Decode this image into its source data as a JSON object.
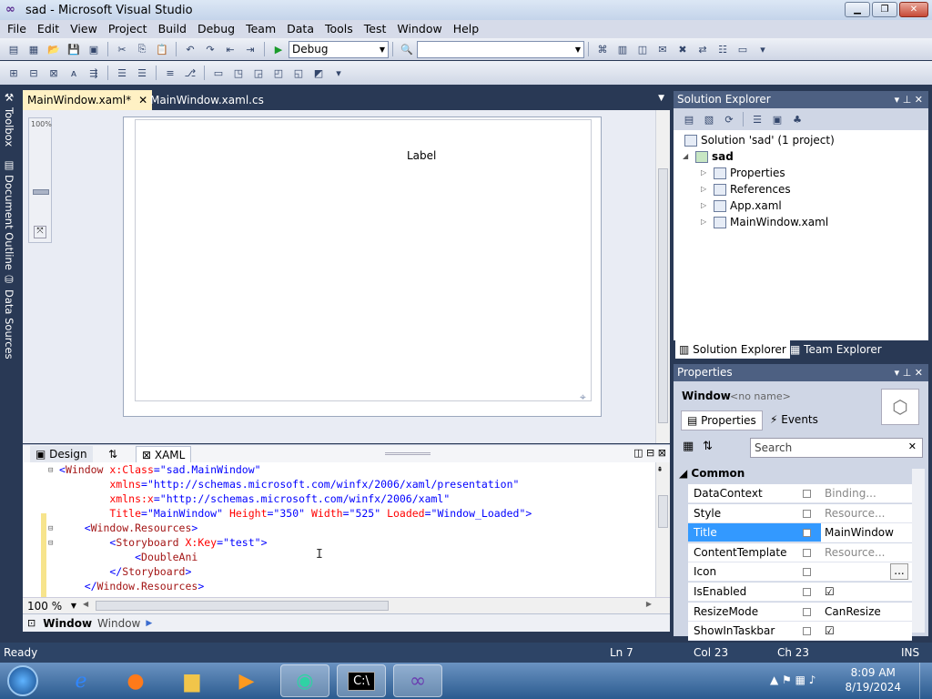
{
  "window": {
    "title": "sad - Microsoft Visual Studio"
  },
  "menu": [
    "File",
    "Edit",
    "View",
    "Project",
    "Build",
    "Debug",
    "Team",
    "Data",
    "Tools",
    "Test",
    "Window",
    "Help"
  ],
  "toolbar": {
    "config": "Debug",
    "platform": ""
  },
  "side_tabs": [
    "Toolbox",
    "Document Outline",
    "Data Sources"
  ],
  "doc_tabs": [
    {
      "label": "MainWindow.xaml*",
      "active": true
    },
    {
      "label": "MainWindow.xaml.cs",
      "active": false
    }
  ],
  "designer": {
    "zoom_label": "100%",
    "label_text": "Label"
  },
  "split_tabs": {
    "design": "Design",
    "swap": "⇅",
    "xaml": "XAML"
  },
  "code": {
    "lines": [
      [
        {
          "c": "p",
          "t": "<"
        },
        {
          "c": "t",
          "t": "Window"
        },
        {
          "c": "a",
          "t": " x:Class"
        },
        {
          "c": "p",
          "t": "=\"sad.MainWindow\""
        }
      ],
      [
        {
          "c": "a",
          "t": "        xmlns"
        },
        {
          "c": "p",
          "t": "=\"http://schemas.microsoft.com/winfx/2006/xaml/presentation\""
        }
      ],
      [
        {
          "c": "a",
          "t": "        xmlns:x"
        },
        {
          "c": "p",
          "t": "=\"http://schemas.microsoft.com/winfx/2006/xaml\""
        }
      ],
      [
        {
          "c": "a",
          "t": "        Title"
        },
        {
          "c": "p",
          "t": "=\"MainWindow\""
        },
        {
          "c": "a",
          "t": " Height"
        },
        {
          "c": "p",
          "t": "=\"350\""
        },
        {
          "c": "a",
          "t": " Width"
        },
        {
          "c": "p",
          "t": "=\"525\""
        },
        {
          "c": "a",
          "t": " Loaded"
        },
        {
          "c": "p",
          "t": "=\"Window_Loaded\">"
        }
      ],
      [
        {
          "c": "p",
          "t": "    <"
        },
        {
          "c": "t",
          "t": "Window.Resources"
        },
        {
          "c": "p",
          "t": ">"
        }
      ],
      [
        {
          "c": "p",
          "t": "        <"
        },
        {
          "c": "t",
          "t": "Storyboard"
        },
        {
          "c": "a",
          "t": " X:Key"
        },
        {
          "c": "p",
          "t": "=\"test\">"
        }
      ],
      [
        {
          "c": "p",
          "t": "            <"
        },
        {
          "c": "t",
          "t": "DoubleAni"
        }
      ],
      [
        {
          "c": "p",
          "t": "        </"
        },
        {
          "c": "t",
          "t": "Storyboard"
        },
        {
          "c": "p",
          "t": ">"
        }
      ],
      [
        {
          "c": "p",
          "t": "    </"
        },
        {
          "c": "t",
          "t": "Window.Resources"
        },
        {
          "c": "p",
          "t": ">"
        }
      ]
    ]
  },
  "editor_zoom": "100 %",
  "breadcrumb": {
    "element": "Window",
    "type": "Window"
  },
  "solution_explorer": {
    "title": "Solution Explorer",
    "solution": "Solution 'sad' (1 project)",
    "project": "sad",
    "items": [
      "Properties",
      "References",
      "App.xaml",
      "MainWindow.xaml"
    ],
    "tabs": [
      "Solution Explorer",
      "Team Explorer"
    ]
  },
  "properties": {
    "title": "Properties",
    "object_type": "Window",
    "object_name": "<no name>",
    "tab_properties": "Properties",
    "tab_events": "Events",
    "search_placeholder": "Search",
    "category": "Common",
    "rows": [
      {
        "name": "DataContext",
        "value": "Binding...",
        "gray": true
      },
      {
        "name": "Style",
        "value": "Resource...",
        "gray": true
      },
      {
        "name": "Title",
        "value": "MainWindow",
        "selected": true
      },
      {
        "name": "ContentTemplate",
        "value": "Resource...",
        "gray": true
      },
      {
        "name": "Icon",
        "value": ""
      },
      {
        "name": "IsEnabled",
        "value": "☑"
      },
      {
        "name": "ResizeMode",
        "value": "CanResize"
      },
      {
        "name": "ShowInTaskbar",
        "value": "☑"
      }
    ]
  },
  "status": {
    "state": "Ready",
    "ln": "Ln 7",
    "col": "Col 23",
    "ch": "Ch 23",
    "mode": "INS"
  },
  "clock": {
    "time": "8:09 AM",
    "date": "8/19/2024"
  },
  "colors": {
    "accent": "#293955",
    "tab_active": "#fff1c4",
    "selection": "#3399ff"
  }
}
